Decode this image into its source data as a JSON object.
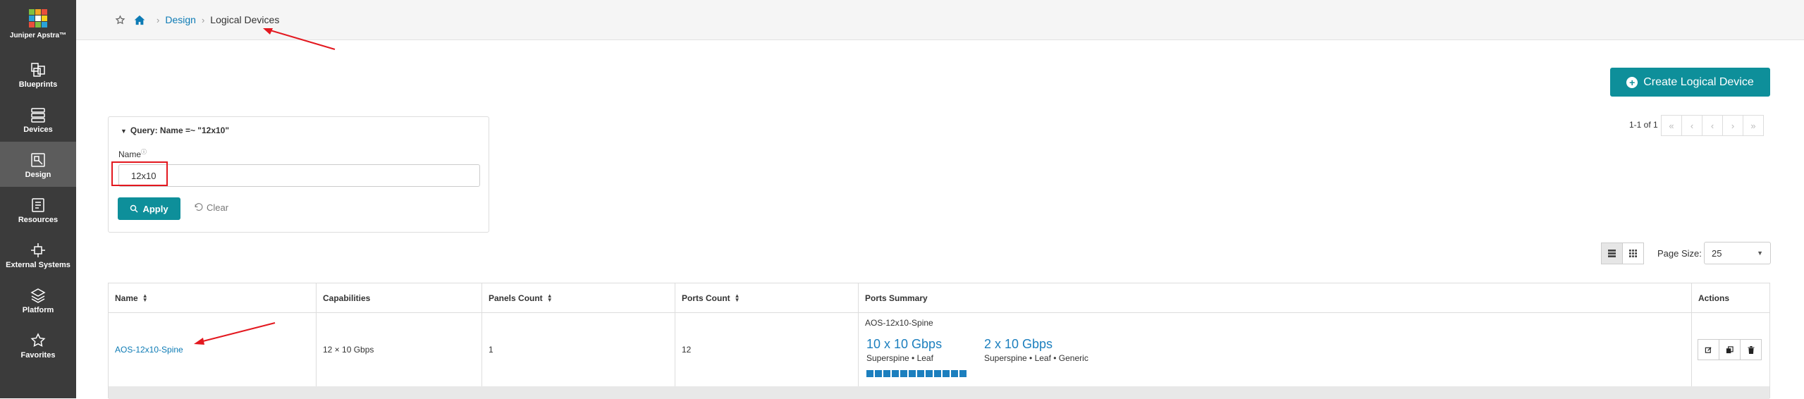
{
  "app": {
    "brand_name": "Juniper Apstra™"
  },
  "sidebar": {
    "items": [
      {
        "label": "Blueprints"
      },
      {
        "label": "Devices"
      },
      {
        "label": "Design"
      },
      {
        "label": "Resources"
      },
      {
        "label": "External Systems"
      },
      {
        "label": "Platform"
      },
      {
        "label": "Favorites"
      }
    ],
    "active": "Design"
  },
  "breadcrumb": {
    "section": "Design",
    "current": "Logical Devices"
  },
  "toolbar": {
    "create_label": "Create Logical Device"
  },
  "query": {
    "title": "Query: Name =~ \"12x10\"",
    "name_label": "Name",
    "name_value": "12x10",
    "apply_label": "Apply",
    "clear_label": "Clear"
  },
  "pagination": {
    "range": "1-1 of 1",
    "buttons": [
      "«",
      "‹",
      "‹",
      "›",
      "»"
    ]
  },
  "page_size": {
    "label": "Page Size:",
    "value": "25"
  },
  "table": {
    "columns": [
      "Name",
      "Capabilities",
      "Panels Count",
      "Ports Count",
      "Ports Summary",
      "Actions"
    ],
    "rows": [
      {
        "name": "AOS-12x10-Spine",
        "capabilities": "12 × 10 Gbps",
        "panels_count": "1",
        "ports_count": "12",
        "ports_summary": {
          "title": "AOS-12x10-Spine",
          "groups": [
            {
              "speed": "10 x 10 Gbps",
              "roles": "Superspine • Leaf"
            },
            {
              "speed": "2 x 10 Gbps",
              "roles": "Superspine • Leaf • Generic"
            }
          ],
          "port_count": 12
        }
      }
    ]
  },
  "colors": {
    "accent": "#0e8f9a",
    "link": "#0d7bb5",
    "sidebar": "#3b3b3b",
    "annotation": "#e3181f"
  }
}
